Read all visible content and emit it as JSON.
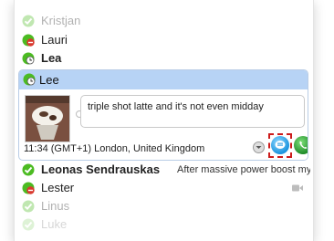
{
  "contacts": [
    {
      "name": "Kristjan",
      "status": "online",
      "weight": "normal"
    },
    {
      "name": "Lauri",
      "status": "do-not-disturb",
      "weight": "normal"
    },
    {
      "name": "Lea",
      "status": "away",
      "weight": "bold"
    },
    {
      "name": "Lee",
      "status": "away",
      "weight": "normal",
      "expanded": true
    },
    {
      "name": "Leonas Sendrauskas",
      "status": "online",
      "weight": "bold",
      "mood": "After massive power boost my Z..."
    },
    {
      "name": "Lester",
      "status": "do-not-disturb",
      "weight": "normal",
      "has_video": true
    },
    {
      "name": "Linus",
      "status": "online",
      "weight": "normal"
    },
    {
      "name": "Luke",
      "status": "online",
      "weight": "normal"
    }
  ],
  "expanded_contact": {
    "name": "Lee",
    "mood_message": "triple shot latte and it's not even midday",
    "local_time": "11:34 (GMT+1)",
    "location": "London, United Kingdom"
  },
  "icons": {
    "online": "green-check-icon",
    "away": "green-clock-icon",
    "do-not-disturb": "red-minus-icon",
    "video": "video-camera-icon",
    "chat": "chat-bubble-icon",
    "call": "phone-icon",
    "dropdown": "chevron-down-icon"
  },
  "colors": {
    "highlight": "#b7d3f5",
    "online": "#4cbb22",
    "dnd": "#d93a2f",
    "chat_button": "#1b94de",
    "call_button": "#1f8c2a",
    "focus_outline": "#cc1b1b"
  }
}
